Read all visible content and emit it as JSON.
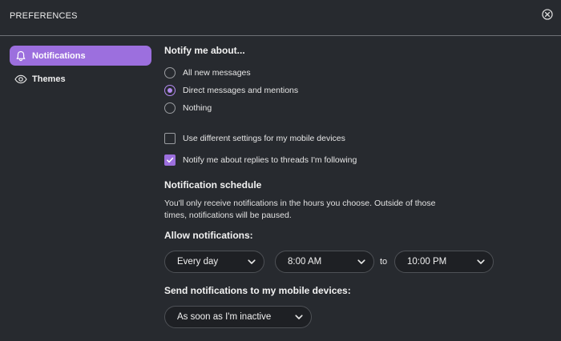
{
  "window": {
    "title": "PREFERENCES",
    "close_icon": "close-circle-icon"
  },
  "sidebar": {
    "items": [
      {
        "label": "Notifications",
        "icon": "bell-icon",
        "active": true
      },
      {
        "label": "Themes",
        "icon": "eye-icon",
        "active": false
      }
    ]
  },
  "notify": {
    "heading": "Notify me about...",
    "options": [
      {
        "label": "All new messages",
        "selected": false
      },
      {
        "label": "Direct messages and mentions",
        "selected": true
      },
      {
        "label": "Nothing",
        "selected": false
      }
    ]
  },
  "checkboxes": [
    {
      "label": "Use different settings for my mobile devices",
      "checked": false
    },
    {
      "label": "Notify me about replies to threads I'm following",
      "checked": true
    }
  ],
  "schedule": {
    "heading": "Notification schedule",
    "description": "You'll only receive notifications in the hours you choose. Outside of those times, notifications will be paused.",
    "allow_label": "Allow notifications:",
    "days_value": "Every day",
    "start_value": "8:00 AM",
    "to_label": "to",
    "end_value": "10:00 PM"
  },
  "mobile": {
    "heading": "Send notifications to my mobile devices:",
    "value": "As soon as I'm inactive"
  },
  "colors": {
    "accent": "#9c6fde",
    "background": "#272a2f",
    "field": "#1e2024"
  }
}
